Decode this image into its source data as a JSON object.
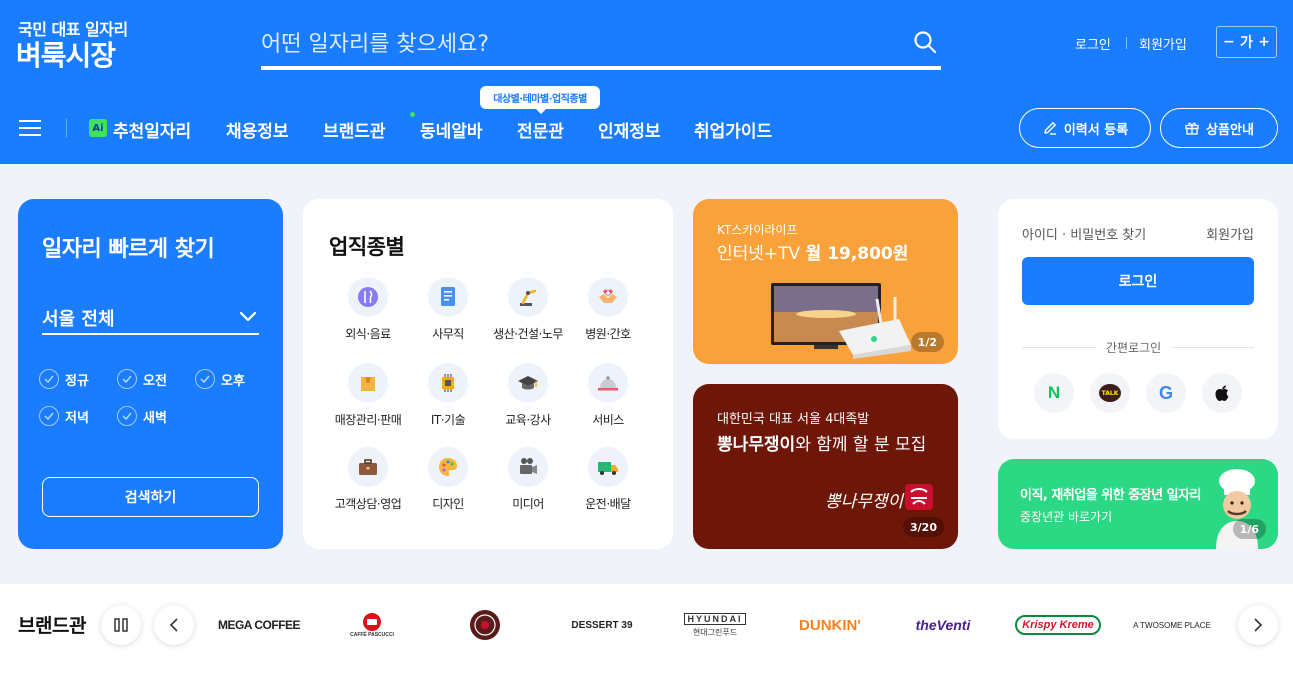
{
  "header": {
    "logo_sub": "국민 대표 일자리",
    "logo_main": "벼룩시장",
    "search_placeholder": "어떤 일자리를 찾으세요?",
    "login": "로그인",
    "signup": "회원가입",
    "font_minus": "−",
    "font_label": "가",
    "font_plus": "+"
  },
  "nav": {
    "ai_badge": "Ai",
    "items": [
      "추천일자리",
      "채용정보",
      "브랜드관",
      "동네알바",
      "전문관",
      "인재정보",
      "취업가이드"
    ],
    "tooltip": "대상별·테마별·업직종별",
    "resume_btn": "이력서 등록",
    "product_btn": "상품안내"
  },
  "quick": {
    "title": "일자리 빠르게 찾기",
    "region": "서울 전체",
    "options": [
      "정규",
      "오전",
      "오후",
      "저녁",
      "새벽"
    ],
    "search_btn": "검색하기"
  },
  "category": {
    "title": "업직종별",
    "items": [
      {
        "label": "외식·음료",
        "icon": "dining-icon"
      },
      {
        "label": "사무직",
        "icon": "document-icon"
      },
      {
        "label": "생산·건설·노무",
        "icon": "crane-icon"
      },
      {
        "label": "병원·간호",
        "icon": "medical-icon"
      },
      {
        "label": "매장관리·판매",
        "icon": "box-icon"
      },
      {
        "label": "IT·기술",
        "icon": "chip-icon"
      },
      {
        "label": "교육·강사",
        "icon": "graduation-cap-icon"
      },
      {
        "label": "서비스",
        "icon": "bell-icon"
      },
      {
        "label": "고객상담·영업",
        "icon": "briefcase-icon"
      },
      {
        "label": "디자인",
        "icon": "palette-icon"
      },
      {
        "label": "미디어",
        "icon": "camera-icon"
      },
      {
        "label": "운전·배달",
        "icon": "truck-icon"
      }
    ]
  },
  "banner1": {
    "small": "KT스카이라이프",
    "title_pre": "인터넷+TV ",
    "title_bold": "월 19,800원",
    "counter": "1/2"
  },
  "banner2": {
    "small": "대한민국 대표 서울 4대족발",
    "title_bold": "뽕나무쟁이",
    "title_rest": "와 함께 할 분 모집",
    "logo_text": "뽕나무쟁이",
    "counter": "3/20"
  },
  "login_card": {
    "find": "아이디 · 비밀번호 찾기",
    "join": "회원가입",
    "login_btn": "로그인",
    "easy_login": "간편로그인",
    "naver": "N",
    "kakao": "TALK",
    "google": "G"
  },
  "mid_banner": {
    "title": "이직, 재취업을 위한 중장년 일자리",
    "sub": "중장년관 바로가기",
    "counter": "1/6"
  },
  "brands": {
    "title": "브랜드관",
    "items": [
      "MEGA COFFEE",
      "CAFFÈ PASCUCCI",
      "HOLLYS COFFEE",
      "DESSERT 39",
      "HYUNDAI",
      "현대그린푸드",
      "DUNKIN'",
      "theVenti",
      "Krispy Kreme",
      "A TWOSOME PLACE"
    ]
  },
  "colors": {
    "primary": "#1a7cff",
    "green": "#2bd884",
    "orange": "#f9a23c",
    "maroon": "#6e1608"
  }
}
